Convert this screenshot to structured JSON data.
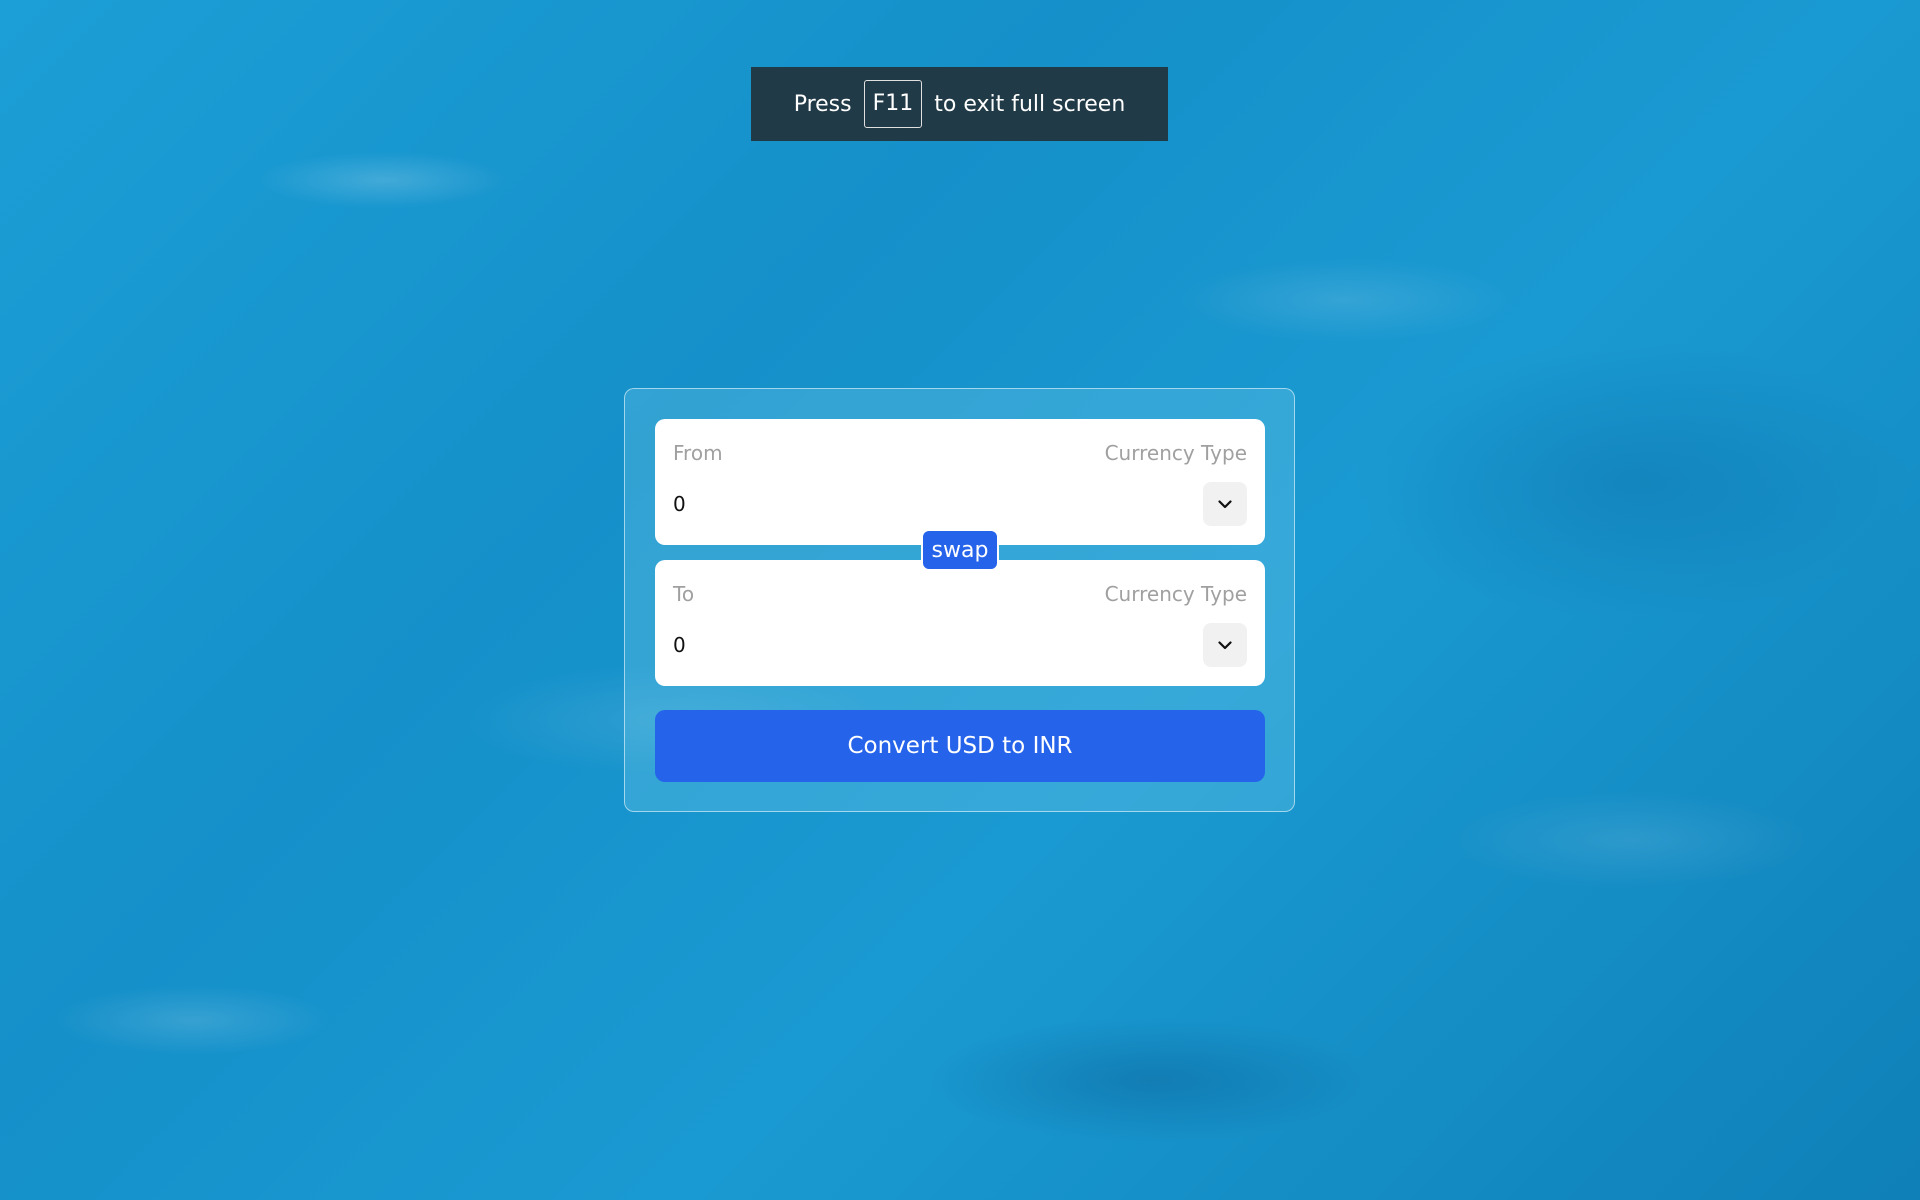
{
  "fullscreen_banner": {
    "prefix": "Press",
    "key": "F11",
    "suffix": "to exit full screen"
  },
  "from": {
    "label": "From",
    "currency_type_label": "Currency Type",
    "amount": "0",
    "select_icon": "chevron-down-icon"
  },
  "swap_label": "swap",
  "to": {
    "label": "To",
    "currency_type_label": "Currency Type",
    "amount": "0",
    "select_icon": "chevron-down-icon"
  },
  "convert_label": "Convert USD to INR",
  "colors": {
    "accent": "#2563eb",
    "banner_bg": "#232d34",
    "background": "#1a9ad2"
  }
}
